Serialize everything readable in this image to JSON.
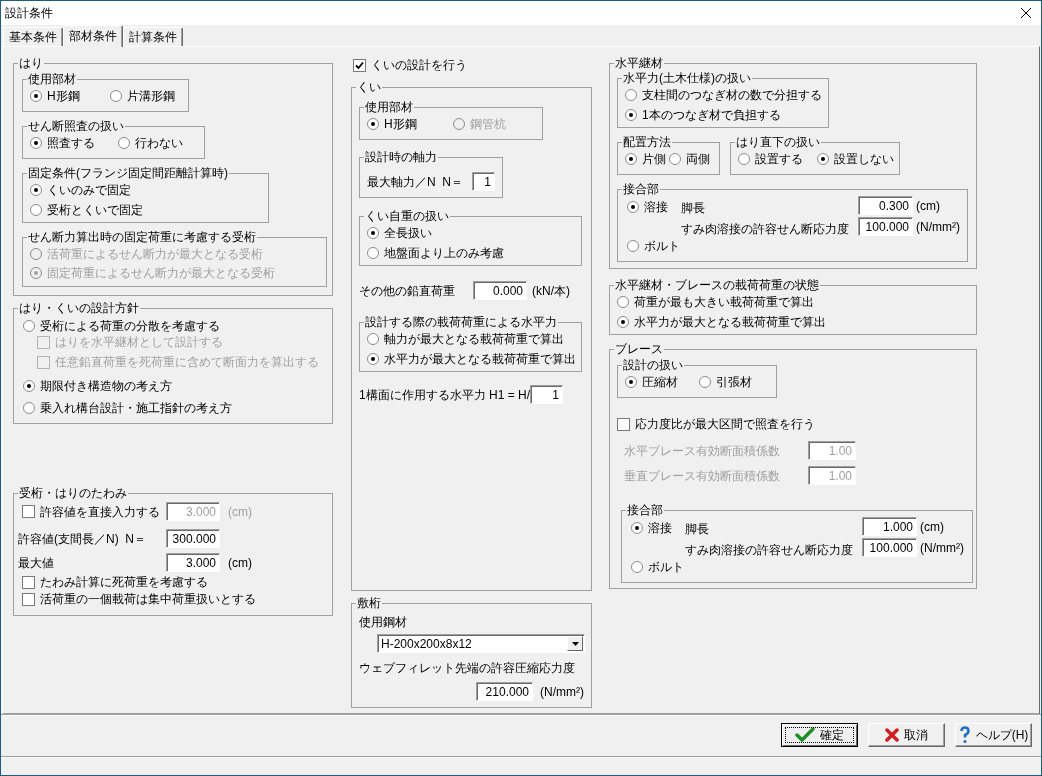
{
  "window": {
    "title": "設計条件"
  },
  "tabs": [
    {
      "label": "基本条件",
      "selected": false
    },
    {
      "label": "部材条件",
      "selected": true
    },
    {
      "label": "計算条件",
      "selected": false
    }
  ],
  "beam": {
    "title": "はり",
    "member": {
      "title": "使用部材",
      "options": [
        {
          "label": "H形鋼",
          "selected": true
        },
        {
          "label": "片溝形鋼",
          "selected": false
        }
      ]
    },
    "shear_check": {
      "title": "せん断照査の扱い",
      "options": [
        {
          "label": "照査する",
          "selected": true
        },
        {
          "label": "行わない",
          "selected": false
        }
      ]
    },
    "fixing": {
      "title": "固定条件(フランジ固定間距離計算時)",
      "options": [
        {
          "label": "くいのみで固定",
          "selected": true
        },
        {
          "label": "受桁とくいで固定",
          "selected": false
        }
      ]
    },
    "shear_girder": {
      "title": "せん断力算出時の固定荷重に考慮する受桁",
      "options": [
        {
          "label": "活荷重によるせん断力が最大となる受桁",
          "selected": false,
          "disabled": true
        },
        {
          "label": "固定荷重によるせん断力が最大となる受桁",
          "selected": true,
          "disabled": true
        }
      ]
    }
  },
  "design_policy": {
    "title": "はり・くいの設計方針",
    "items": [
      {
        "kind": "radio",
        "label": "受桁による荷重の分散を考慮する",
        "selected": false,
        "disabled": false
      },
      {
        "kind": "checkbox",
        "label": "はりを水平継材として設計する",
        "checked": false,
        "disabled": true
      },
      {
        "kind": "checkbox",
        "label": "任意鉛直荷重を死荷重に含めて断面力を算出する",
        "checked": false,
        "disabled": true
      },
      {
        "kind": "radio",
        "label": "期限付き構造物の考え方",
        "selected": true,
        "disabled": false
      },
      {
        "kind": "radio",
        "label": "乗入れ構台設計・施工指針の考え方",
        "selected": false,
        "disabled": false
      }
    ]
  },
  "deflection": {
    "title": "受桁・はりのたわみ",
    "rows": [
      {
        "kind": "checkbox",
        "label": "許容値を直接入力する",
        "checked": false,
        "value": "3.000",
        "unit": "(cm)",
        "disabled": true
      },
      {
        "kind": "field",
        "label": "許容値(支間長／N)  N＝",
        "value": "300.000",
        "disabled": false
      },
      {
        "kind": "field",
        "label": "最大値",
        "value": "3.000",
        "unit": "(cm)",
        "disabled": false
      }
    ],
    "checks": [
      {
        "label": "たわみ計算に死荷重を考慮する",
        "checked": false
      },
      {
        "label": "活荷重の一個載荷は集中荷重扱いとする",
        "checked": false
      }
    ]
  },
  "pile_design": {
    "label": "くいの設計を行う",
    "checked": true
  },
  "pile": {
    "title": "くい",
    "member": {
      "title": "使用部材",
      "options": [
        {
          "label": "H形鋼",
          "selected": true,
          "disabled": false
        },
        {
          "label": "鋼管杭",
          "selected": false,
          "disabled": true
        }
      ]
    },
    "axial_force": {
      "title": "設計時の軸力",
      "label": "最大軸力／N  N＝",
      "value": "1"
    },
    "self_weight": {
      "title": "くい自重の扱い",
      "options": [
        {
          "label": "全長扱い",
          "selected": true
        },
        {
          "label": "地盤面より上のみ考慮",
          "selected": false
        }
      ]
    },
    "other_load": {
      "label": "その他の鉛直荷重",
      "value": "0.000",
      "unit": "(kN/本)"
    },
    "horizontal_force": {
      "title": "設計する際の載荷荷重による水平力",
      "options": [
        {
          "label": "軸力が最大となる載荷荷重で算出",
          "selected": false
        },
        {
          "label": "水平力が最大となる載荷荷重で算出",
          "selected": true
        }
      ]
    },
    "h1": {
      "label": "1構面に作用する水平力 H1 = H/",
      "value": "1"
    }
  },
  "sill_beam": {
    "title": "敷桁",
    "steel": {
      "label": "使用鋼材",
      "value": "H-200x200x8x12"
    },
    "stress": {
      "label": "ウェブフィレット先端の許容圧縮応力度",
      "value": "210.000",
      "unit": "(N/mm²)"
    }
  },
  "horizontal_member": {
    "title": "水平継材",
    "force_handling": {
      "title": "水平力(土木仕様)の扱い",
      "options": [
        {
          "label": "支柱間のつなぎ材の数で分担する",
          "selected": false
        },
        {
          "label": "1本のつなぎ材で負担する",
          "selected": true
        }
      ]
    },
    "placement": {
      "title": "配置方法",
      "options": [
        {
          "label": "片側",
          "selected": true
        },
        {
          "label": "両側",
          "selected": false
        }
      ]
    },
    "under_beam": {
      "title": "はり直下の扱い",
      "options": [
        {
          "label": "設置する",
          "selected": false
        },
        {
          "label": "設置しない",
          "selected": true
        }
      ]
    },
    "joint": {
      "title": "接合部",
      "options": [
        {
          "label": "溶接",
          "selected": true
        },
        {
          "label": "ボルト",
          "selected": false
        }
      ],
      "fields": [
        {
          "label": "脚長",
          "value": "0.300",
          "unit": "(cm)"
        },
        {
          "label": "すみ肉溶接の許容せん断応力度",
          "value": "100.000",
          "unit": "(N/mm²)"
        }
      ]
    }
  },
  "load_state": {
    "title": "水平継材・ブレースの載荷荷重の状態",
    "options": [
      {
        "label": "荷重が最も大きい載荷荷重で算出",
        "selected": false
      },
      {
        "label": "水平力が最大となる載荷荷重で算出",
        "selected": true
      }
    ]
  },
  "brace": {
    "title": "ブレース",
    "design": {
      "title": "設計の扱い",
      "options": [
        {
          "label": "圧縮材",
          "selected": true
        },
        {
          "label": "引張材",
          "selected": false
        }
      ]
    },
    "stress_ratio_check": {
      "label": "応力度比が最大区間で照査を行う",
      "checked": false
    },
    "coefficients": [
      {
        "label": "水平ブレース有効断面積係数",
        "value": "1.00",
        "disabled": true
      },
      {
        "label": "垂直ブレース有効断面積係数",
        "value": "1.00",
        "disabled": true
      }
    ],
    "joint": {
      "title": "接合部",
      "options": [
        {
          "label": "溶接",
          "selected": true
        },
        {
          "label": "ボルト",
          "selected": false
        }
      ],
      "fields": [
        {
          "label": "脚長",
          "value": "1.000",
          "unit": "(cm)"
        },
        {
          "label": "すみ肉溶接の許容せん断応力度",
          "value": "100.000",
          "unit": "(N/mm²)"
        }
      ]
    }
  },
  "buttons": [
    {
      "label": "確定",
      "kind": "ok",
      "default": true
    },
    {
      "label": "取消",
      "kind": "cancel",
      "default": false
    },
    {
      "label": "ヘルプ(H)",
      "kind": "help",
      "default": false
    }
  ]
}
